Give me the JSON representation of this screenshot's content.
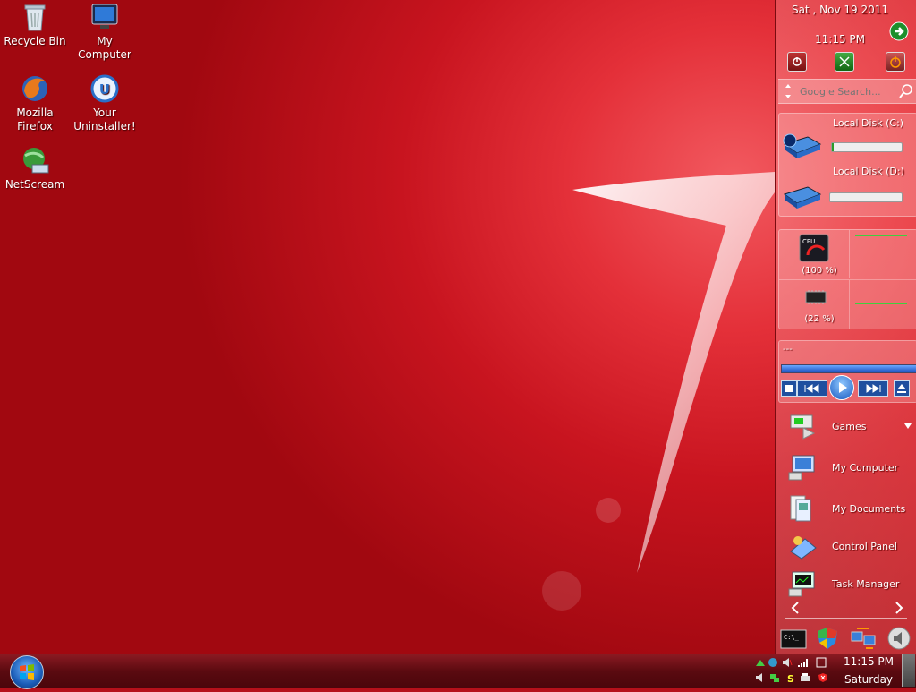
{
  "desktop": {
    "icons": [
      {
        "label": "Recycle Bin",
        "icon": "recycle-bin-icon"
      },
      {
        "label": "My Computer",
        "icon": "computer-icon"
      },
      {
        "label": "Mozilla Firefox",
        "icon": "firefox-icon"
      },
      {
        "label": "Your Uninstaller!",
        "icon": "uninstaller-icon"
      },
      {
        "label": "NetScream",
        "icon": "netscream-icon"
      }
    ]
  },
  "sidebar": {
    "date": "Sat , Nov 19 2011",
    "time": "11:15 PM",
    "search_placeholder": "Google Search...",
    "disks": [
      {
        "label": "Local Disk (C:)",
        "usage": 0.03
      },
      {
        "label": "Local Disk (D:)",
        "usage": 0.0
      }
    ],
    "cpu": {
      "label": "(100 %)",
      "value": 100
    },
    "memory": {
      "label": "(22 %)",
      "value": 22
    },
    "media": {
      "title": "---",
      "progress": 1.0
    },
    "menu": [
      {
        "label": "Games",
        "icon": "games-icon"
      },
      {
        "label": "My Computer",
        "icon": "computer-icon"
      },
      {
        "label": "My Documents",
        "icon": "documents-icon"
      },
      {
        "label": "Control Panel",
        "icon": "control-panel-icon"
      },
      {
        "label": "Task Manager",
        "icon": "task-manager-icon"
      }
    ]
  },
  "taskbar": {
    "clock_time": "11:15 PM",
    "clock_day": "Saturday"
  },
  "colors": {
    "wallpaper": "#c8141f",
    "taskbar": "#5a0a10",
    "disk_fill": "#2a9c2a",
    "graph_line": "#3fcf3f"
  }
}
